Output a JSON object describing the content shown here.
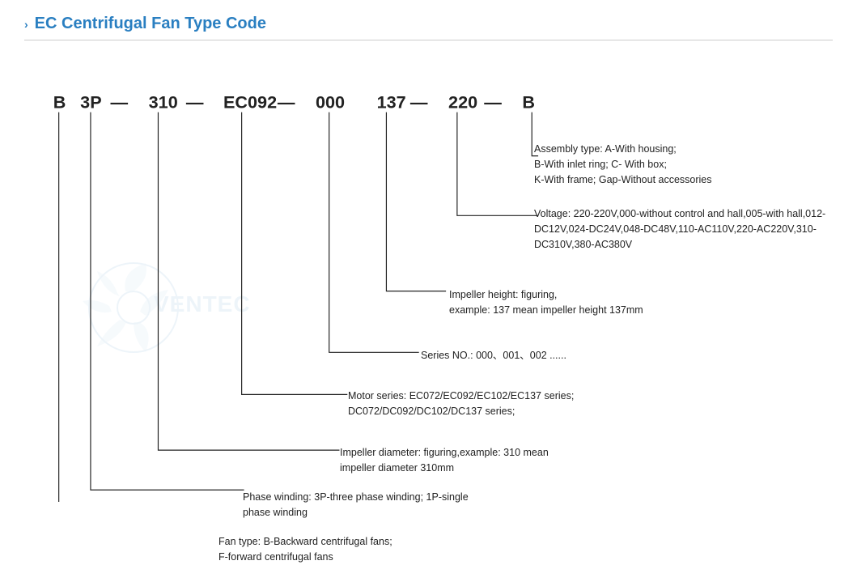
{
  "title": {
    "chevron": "›",
    "text": "EC Centrifugal Fan Type Code"
  },
  "code": {
    "parts": [
      "B",
      "3P",
      "310",
      "EC092",
      "000",
      "137",
      "220",
      "B"
    ],
    "dashes": [
      "—",
      "—",
      "—",
      "—",
      "—",
      "—",
      "—"
    ]
  },
  "annotations": {
    "assembly": "Assembly type:  A-With housing;\nB-With inlet ring;  C- With box;\nK-With frame; Gap-Without accessories",
    "voltage": "Voltage:  220-220V,000-without control and hall,005-with hall,012-DC12V,024-DC24V,048-DC48V,110-AC110V,220-AC220V,310-DC310V,380-AC380V",
    "impeller_height": "Impeller height:   figuring,\nexample: 137 mean impeller height 137mm",
    "series": "Series NO.:  000、001、002 ......",
    "motor": "Motor series:  EC072/EC092/EC102/EC137 series;\nDC072/DC092/DC102/DC137 series;",
    "impeller_diameter": "Impeller diameter:  figuring,example: 310 mean\nimpeller diameter 310mm",
    "phase": "Phase winding:  3P-three phase winding;  1P-single\nphase winding",
    "fan_type": "Fan type:  B-Backward centrifugal fans;\nF-forward centrifugal fans"
  },
  "watermark": "VENTEC"
}
